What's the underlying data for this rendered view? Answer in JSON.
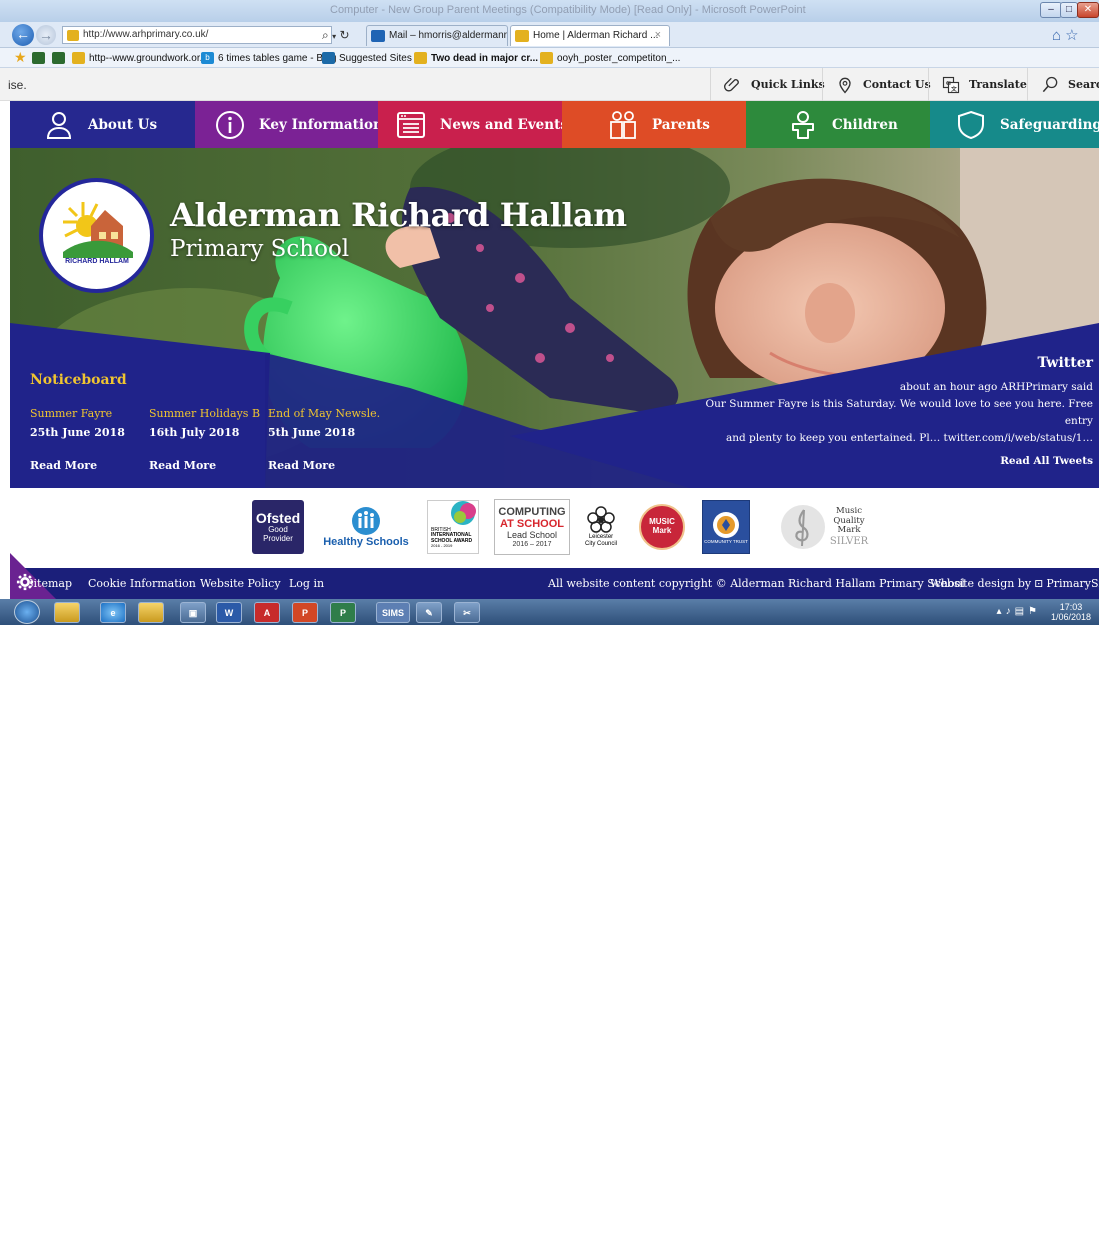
{
  "browser": {
    "window_title": "Computer - New Group Parent Meetings (Compatibility Mode) [Read Only] - Microsoft PowerPoint",
    "address": "http://www.arhprimary.co.uk/",
    "tabs": [
      {
        "label": "Mail – hmorris@aldermanricha..."
      },
      {
        "label": "Home | Alderman Richard ...",
        "close": "×"
      }
    ],
    "favourites": [
      {
        "label": "http--www.groundwork.or..."
      },
      {
        "label": "6 times tables game - Bing"
      },
      {
        "label": "Suggested Sites ▾"
      },
      {
        "label": "Two dead in major cr... ▾"
      },
      {
        "label": "ooyh_poster_competiton_..."
      }
    ]
  },
  "utility": {
    "cut_text": "ise.",
    "links": [
      {
        "label": "Quick Links",
        "icon": "paperclip-icon"
      },
      {
        "label": "Contact Us",
        "icon": "location-pin-icon"
      },
      {
        "label": "Translate",
        "icon": "translate-icon"
      },
      {
        "label": "Search",
        "icon": "search-icon"
      }
    ]
  },
  "nav": [
    {
      "label": "About Us",
      "icon": "person-icon",
      "color": "#26288f"
    },
    {
      "label": "Key Information",
      "icon": "info-icon",
      "color": "#7b2295"
    },
    {
      "label": "News and Events",
      "icon": "newspaper-icon",
      "color": "#c9204d"
    },
    {
      "label": "Parents",
      "icon": "parents-icon",
      "color": "#de4c26"
    },
    {
      "label": "Children",
      "icon": "child-icon",
      "color": "#2d8a3c"
    },
    {
      "label": "Safeguarding",
      "icon": "shield-icon",
      "color": "#168a8a"
    }
  ],
  "hero": {
    "title": "Alderman Richard Hallam",
    "subtitle": "Primary School",
    "logo_text": "RICHARD HALLAM"
  },
  "noticeboard": {
    "title": "Noticeboard",
    "items": [
      {
        "title": "Summer Fayre",
        "date": "25th June 2018",
        "more": "Read More"
      },
      {
        "title": "Summer Holidays B...",
        "date": "16th July 2018",
        "more": "Read More"
      },
      {
        "title": "End of May Newsle...",
        "date": "5th June 2018",
        "more": "Read More"
      }
    ]
  },
  "twitter": {
    "title": "Twitter",
    "meta": "about an hour ago ARHPrimary said",
    "line1": "Our Summer Fayre is this Saturday. We would love to see you here. Free entry",
    "line2": "and plenty to keep you entertained. Pl… twitter.com/i/web/status/1…",
    "read_all": "Read All Tweets"
  },
  "accreditations": {
    "ofsted": {
      "name": "Ofsted",
      "line1": "Good",
      "line2": "Provider"
    },
    "healthy": "Healthy Schools",
    "isa": {
      "l1": "BRITISH",
      "l2": "INTERNATIONAL",
      "l3": "SCHOOL AWARD",
      "l4": "2016 - 2019"
    },
    "computing": {
      "l1": "COMPUTING",
      "l2": "AT SCHOOL",
      "l3": "Lead School",
      "l4": "2016 – 2017"
    },
    "leicester": {
      "l1": "Leicester",
      "l2": "City Council"
    },
    "musicmark": "MUSIC Mark",
    "community": "COMMUNITY TRUST",
    "mqm": {
      "l1": "Music",
      "l2": "Quality",
      "l3": "Mark",
      "l4": "SILVER"
    }
  },
  "footer": {
    "sitemap": "Sitemap",
    "cookie": "Cookie Information",
    "policy": "Website Policy",
    "login": "Log in",
    "copyright": "All website content copyright © Alderman Richard Hallam Primary School",
    "design": "Website design by",
    "design_brand": "PrimarySite"
  },
  "taskbar": {
    "sims": "SIMS",
    "time": "17:03",
    "date": "1/06/2018"
  },
  "overlay": "books, photos and letters"
}
